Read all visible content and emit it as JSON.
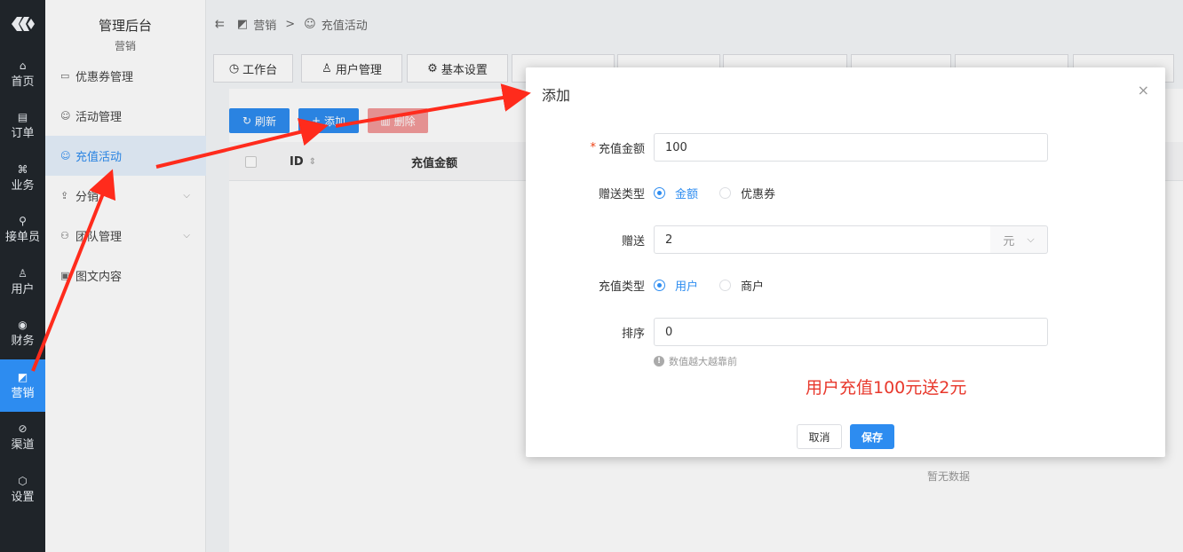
{
  "rail": {
    "items": [
      {
        "icon": "⌂",
        "label": "首页"
      },
      {
        "icon": "▤",
        "label": "订单"
      },
      {
        "icon": "⌘",
        "label": "业务"
      },
      {
        "icon": "⚲",
        "label": "接单员"
      },
      {
        "icon": "♙",
        "label": "用户"
      },
      {
        "icon": "◉",
        "label": "财务"
      },
      {
        "icon": "◩",
        "label": "营销"
      },
      {
        "icon": "⊘",
        "label": "渠道"
      },
      {
        "icon": "⬡",
        "label": "设置"
      }
    ]
  },
  "sidebar": {
    "title": "管理后台",
    "subtitle": "营销",
    "items": [
      {
        "icon": "▭",
        "label": "优惠券管理"
      },
      {
        "icon": "☺",
        "label": "活动管理"
      },
      {
        "icon": "☺",
        "label": "充值活动"
      },
      {
        "icon": "⇪",
        "label": "分销"
      },
      {
        "icon": "⚇",
        "label": "团队管理"
      },
      {
        "icon": "▣",
        "label": "图文内容"
      }
    ],
    "chevron": "⌵"
  },
  "breadcrumb": {
    "menu_icon": "⇇",
    "icon1": "◩",
    "item1": "营销",
    "sep": ">",
    "icon2": "☺",
    "item2": "充值活动"
  },
  "tabs": [
    {
      "icon": "◷",
      "label": "工作台"
    },
    {
      "icon": "♙",
      "label": "用户管理"
    },
    {
      "icon": "⚙",
      "label": "基本设置"
    }
  ],
  "toolbar": {
    "refresh_icon": "↻",
    "refresh": "刷新",
    "add_icon": "+",
    "add": "添加",
    "delete_icon": "▥",
    "delete": "删除"
  },
  "table": {
    "col_id": "ID",
    "sort_icon": "⇕",
    "col_amount": "充值金额",
    "empty": "暂无数据"
  },
  "modal": {
    "title": "添加",
    "close": "×",
    "required_mark": "*",
    "amount_label": "充值金额",
    "amount_value": "100",
    "gift_type_label": "赠送类型",
    "gift_type_options": [
      "金额",
      "优惠券"
    ],
    "gift_label": "赠送",
    "gift_value": "2",
    "gift_unit": "元",
    "unit_chevron": "⌵",
    "recharge_type_label": "充值类型",
    "recharge_type_options": [
      "用户",
      "商户"
    ],
    "sort_label": "排序",
    "sort_value": "0",
    "hint_icon": "!",
    "hint": "数值越大越靠前",
    "note": "用户充值100元送2元",
    "cancel": "取消",
    "save": "保存"
  },
  "colors": {
    "primary": "#2d8cf0",
    "rail_bg": "#1f2429",
    "annotation_red": "#e8382c"
  }
}
